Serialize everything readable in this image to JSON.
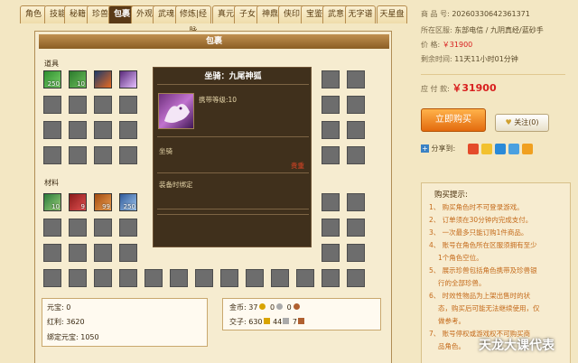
{
  "tabs": [
    "角色",
    "技能",
    "秘籍",
    "珍兽",
    "包裹",
    "外观",
    "武魂",
    "修炼|经脉",
    "真元",
    "子女",
    "神鼎",
    "侠印",
    "宝鉴",
    "武意",
    "无字谱",
    "天星盘"
  ],
  "active_tab": "包裹",
  "panel": {
    "title": "包裹",
    "items_label": "道具",
    "materials_label": "材料"
  },
  "items": [
    {
      "qty": "250"
    },
    {
      "qty": "10"
    },
    {
      "qty": ""
    },
    {
      "qty": ""
    }
  ],
  "materials": [
    {
      "qty": "10"
    },
    {
      "qty": "9"
    },
    {
      "qty": "99"
    },
    {
      "qty": "250"
    }
  ],
  "tooltip": {
    "title": "坐骑：九尾神狐",
    "level": "携带等级:10",
    "type": "坐骑",
    "tag": "贵重",
    "bind": "装备时绑定"
  },
  "stats": {
    "yuanbao_label": "元宝:",
    "yuanbao": "0",
    "hongli_label": "红利:",
    "hongli": "3620",
    "bind_yuanbao_label": "绑定元宝:",
    "bind_yuanbao": "1050",
    "gold_label": "金币:",
    "gold": "37",
    "silver": "0",
    "copper": "0",
    "jiaozi_label": "交子:",
    "jiaozi_a": "630",
    "jiaozi_b": "44",
    "jiaozi_c": "7"
  },
  "listing": {
    "product_no_label": "商 品 号:",
    "product_no": "20260330642361371",
    "region_label": "所在区服:",
    "region": "东部电信 / 九阴真经/蓝砂手",
    "price_label": "价    格:",
    "price": "￥31900",
    "time_label": "剩余时间:",
    "time_left": "11天11小时01分钟",
    "due_label": "应 付 款:",
    "due": "￥31900",
    "buy_label": "立即购买",
    "follow_label": "关注",
    "follow_count": "(0)",
    "share_label": "分享到:"
  },
  "tips": {
    "title": "购买提示:",
    "lines": [
      "1、 购买角色时不可登录游戏。",
      "2、 订单须在30分钟内完成支付。",
      "3、 一次最多只能订购1件商品。",
      "4、 账号在角色所在区服须拥有至少",
      "1个角色空位。",
      "5、 展示珍兽包括角色携带及珍兽银",
      "行的全部珍兽。",
      "6、 时效性物品为上架出售时的状",
      "态，购买后可能无法继续使用，仅",
      "做参考。",
      "7、 账号停权或游戏权不可购买商",
      "品角色。"
    ]
  },
  "watermark": "天龙大课代表",
  "colors": {
    "accent": "#e36a0e",
    "price": "#d81e1e",
    "tab_active": "#5a3a17"
  }
}
